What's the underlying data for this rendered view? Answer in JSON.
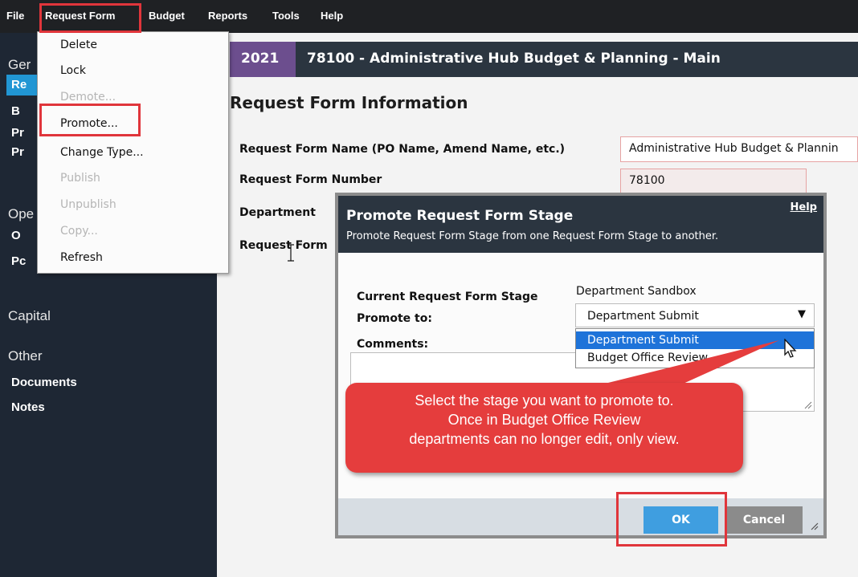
{
  "menubar": {
    "items": [
      "File",
      "Request Form",
      "Budget",
      "Reports",
      "Tools",
      "Help"
    ]
  },
  "dropdown": {
    "items": [
      {
        "label": "Delete",
        "enabled": true
      },
      {
        "label": "Lock",
        "enabled": true
      },
      {
        "label": "Demote...",
        "enabled": false
      },
      {
        "label": "Promote...",
        "enabled": true
      },
      {
        "label": "Change Type...",
        "enabled": true
      },
      {
        "label": "Publish",
        "enabled": false
      },
      {
        "label": "Unpublish",
        "enabled": false
      },
      {
        "label": "Copy...",
        "enabled": false
      },
      {
        "label": "Refresh",
        "enabled": true
      }
    ]
  },
  "sidebar": {
    "section_general": "Ger",
    "items_general": [
      "Re",
      "B",
      "Pr",
      "Pr"
    ],
    "section_ops": "Ope",
    "items_ops": [
      "O",
      "Pc"
    ],
    "section_capital": "Capital",
    "section_other": "Other",
    "items_other": [
      "Documents",
      "Notes"
    ]
  },
  "titlebar": {
    "year": "2021",
    "title": "78100 - Administrative Hub Budget & Planning - Main"
  },
  "form": {
    "heading": "Request Form Information",
    "name_label": "Request Form Name (PO Name, Amend Name, etc.)",
    "name_value": "Administrative Hub Budget & Plannin",
    "number_label": "Request Form Number",
    "number_value": "78100",
    "department_label": "Department",
    "type_label": "Request Form"
  },
  "dialog": {
    "title": "Promote Request Form Stage",
    "subtitle": "Promote Request Form Stage from one Request Form Stage to another.",
    "help": "Help",
    "current_label": "Current Request Form Stage",
    "current_value": "Department Sandbox",
    "promote_label": "Promote to:",
    "promote_value": "Department Submit",
    "options": [
      "Department Submit",
      "Budget Office Review"
    ],
    "comments_label": "Comments:",
    "ok": "OK",
    "cancel": "Cancel"
  },
  "callout": {
    "lines": [
      "Select the stage you want to promote to.",
      "Once in Budget Office Review",
      "departments can no longer edit, only view."
    ]
  },
  "colors": {
    "highlight_red": "#e0353b",
    "accent_blue": "#2196d4",
    "dark_header": "#2b3540",
    "year_purple": "#6c4e8e"
  }
}
